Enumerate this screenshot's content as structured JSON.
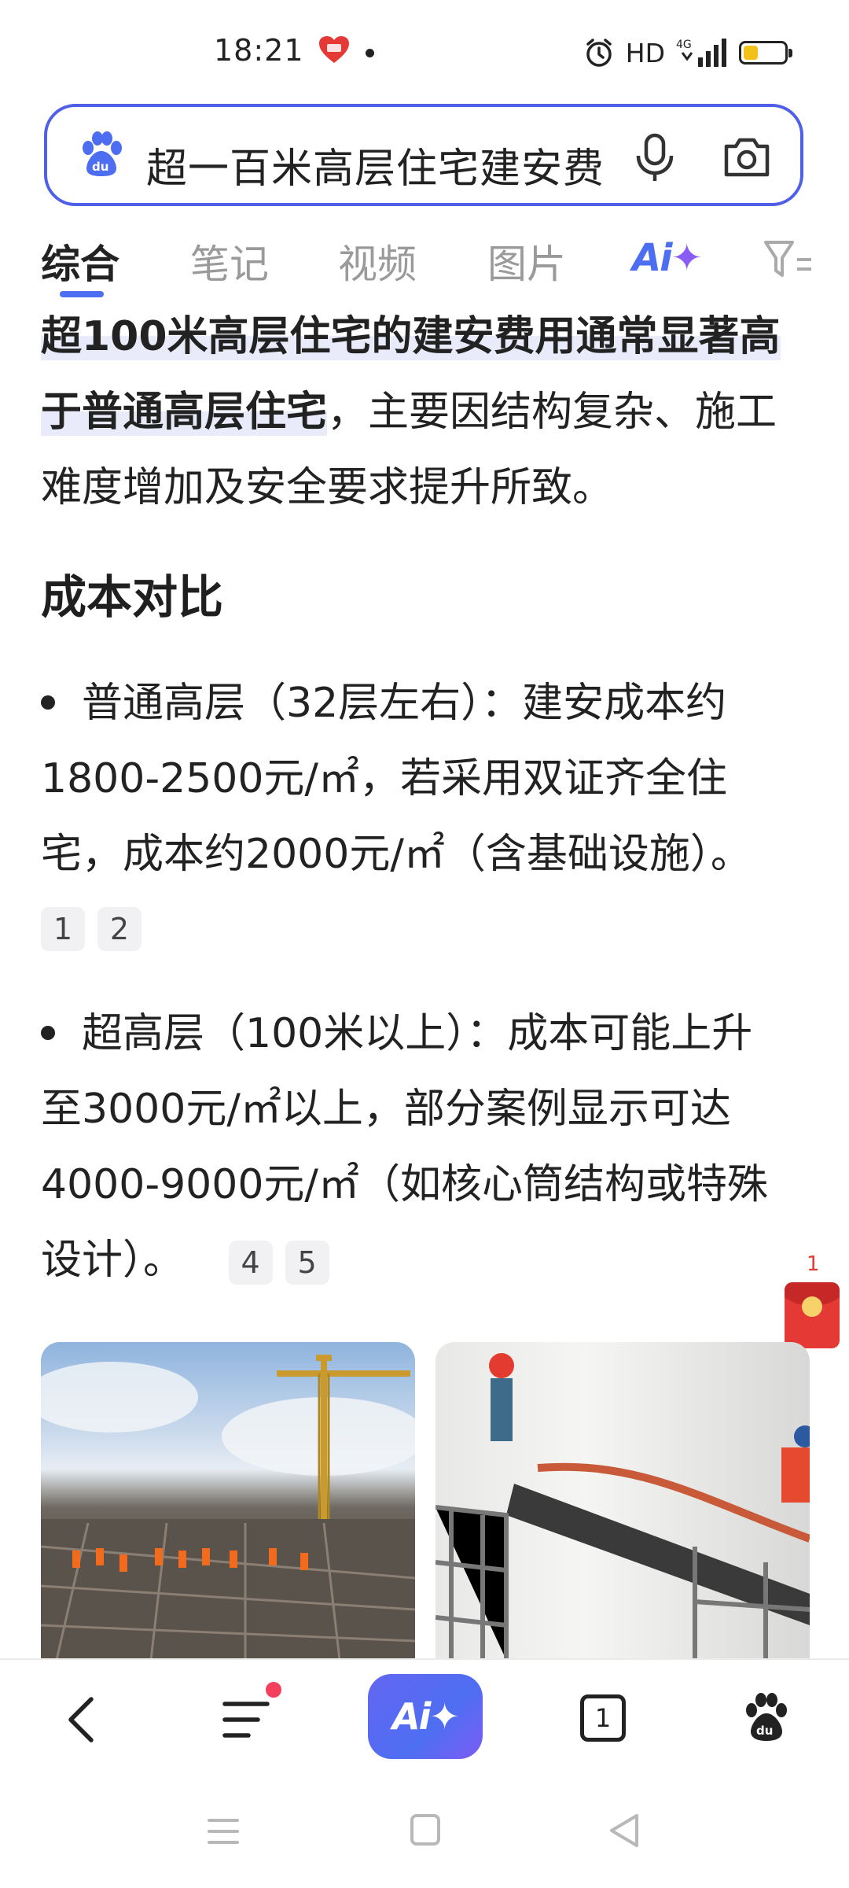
{
  "status_bar": {
    "time": "18:21",
    "network": "HD",
    "signal": "4G",
    "icons": [
      "alarm-icon",
      "signal-icon",
      "battery-icon"
    ],
    "battery_level": 0.35
  },
  "search": {
    "query": "超一百米高层住宅建安费",
    "icons": [
      "baidu-paw-icon",
      "mic-icon",
      "camera-icon"
    ]
  },
  "tabs": {
    "items": [
      "综合",
      "笔记",
      "视频",
      "图片"
    ],
    "ai_label": "Ai",
    "active_index": 0
  },
  "answer": {
    "highlight": "超100米高层住宅的建安费用通常显著高于普通高层住宅",
    "rest": "，主要因结构复杂、施工难度增加及安全要求提升所致。",
    "section_title": "成本对比",
    "bullets": [
      {
        "lines": [
          "普通高层（32层左右）：建安成本约",
          "1800-2500元/㎡，若采用双证齐全住",
          "宅，成本约2000元/㎡（含基础设施）。"
        ],
        "citations": [
          "1",
          "2"
        ]
      },
      {
        "lines": [
          "超高层（100米以上）：成本可能上升",
          "至3000元/㎡以上，部分案例显示可达",
          "4000-9000元/㎡（如核心筒结构或特殊",
          "设计）。"
        ],
        "citations": [
          "4",
          "5"
        ]
      }
    ]
  },
  "red_packet": {
    "count": "1"
  },
  "images": [
    "construction-site-image",
    "interior-scaffolding-image"
  ],
  "bottom_nav": {
    "ai_label": "Ai",
    "tab_count": "1"
  },
  "colors": {
    "accent": "#4e6ef2",
    "highlight_bg": "#e9ebfb",
    "badge_red": "#f43f5e",
    "red_packet": "#e53935"
  }
}
